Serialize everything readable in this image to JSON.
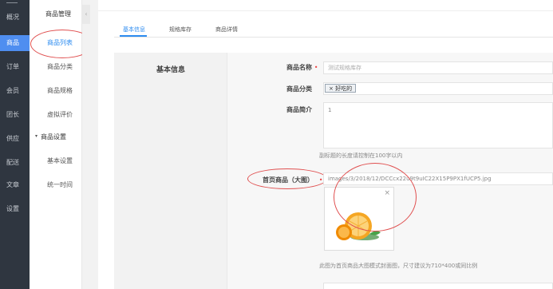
{
  "nav": {
    "items": [
      "概况",
      "商品",
      "订单",
      "会员",
      "团长",
      "供应",
      "配送",
      "文章",
      "设置"
    ],
    "active_index": 1
  },
  "subnav": {
    "section_title": "商品管理",
    "items": [
      "商品列表",
      "商品分类",
      "商品规格",
      "虚拟评价"
    ],
    "settings_title": "商品设置",
    "settings_items": [
      "基本设置",
      "统一时间"
    ],
    "collapse_icon": "‹"
  },
  "tabs": [
    "基本信息",
    "规格库存",
    "商品详情"
  ],
  "form": {
    "section_title": "基本信息",
    "name_label": "商品名称",
    "required_mark": "•",
    "name_placeholder": "测试规格库存",
    "category_label": "商品分类",
    "category_tag": "× 好吃的",
    "intro_label": "商品简介",
    "intro_value": "1",
    "intro_help": "副标题的长度请控制在100字以内",
    "image_label": "首页商品（大图）",
    "image_path": "images/3/2018/12/DCCcx22u9t9uIC22X15P9PX1fUCP5.jpg",
    "image_help": "此图为首页商品大图模式封面图，尺寸建议为710*400或同比例",
    "remove_icon": "×"
  }
}
